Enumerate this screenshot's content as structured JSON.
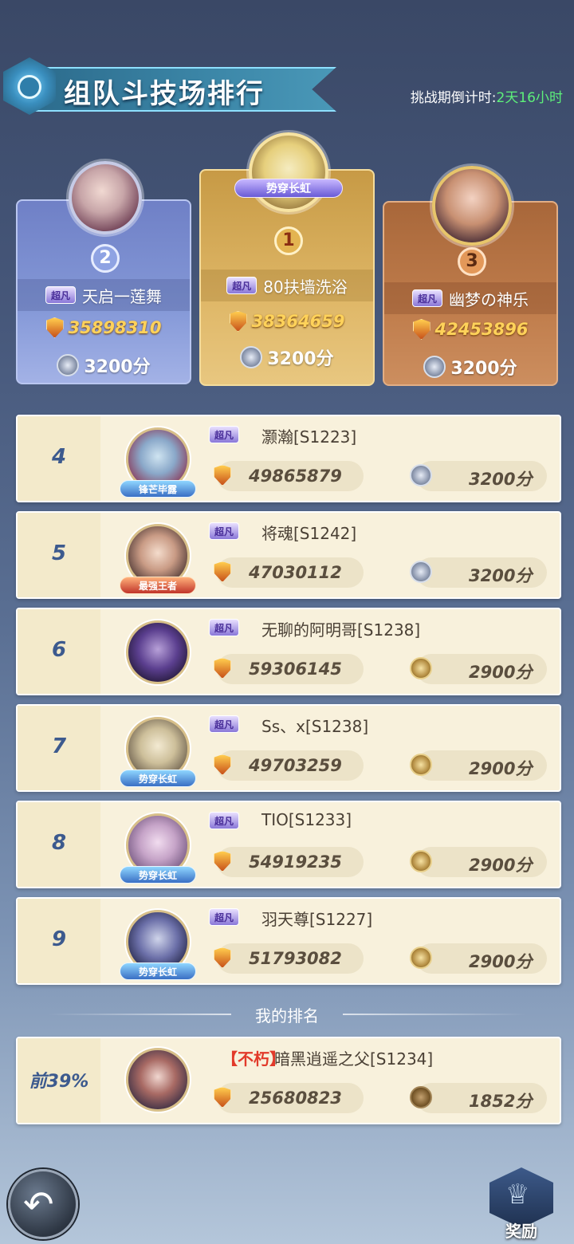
{
  "header": {
    "title": "组队斗技场排行",
    "countdown_label": "挑战期倒计时:",
    "countdown_value": "2天16小时"
  },
  "top3": [
    {
      "rank": "1",
      "tag": "势穿长虹",
      "tier": "超凡",
      "name": "80扶墙洗浴",
      "power": "38364659",
      "score": "3200分"
    },
    {
      "rank": "2",
      "tier": "超凡",
      "name": "天启一莲舞",
      "power": "35898310",
      "score": "3200分"
    },
    {
      "rank": "3",
      "tier": "超凡",
      "name": "幽梦の神乐",
      "power": "42453896",
      "score": "3200分"
    }
  ],
  "list": [
    {
      "rank": "4",
      "badge": "锋芒毕露",
      "tier": "超凡",
      "name": "灏瀚[S1223]",
      "power": "49865879",
      "score": "3200分",
      "crest": "silver"
    },
    {
      "rank": "5",
      "badge": "最强王者",
      "tier": "超凡",
      "name": "将魂[S1242]",
      "power": "47030112",
      "score": "3200分",
      "crest": "silver"
    },
    {
      "rank": "6",
      "badge": "",
      "tier": "超凡",
      "name": "无聊的阿明哥[S1238]",
      "power": "59306145",
      "score": "2900分",
      "crest": "gold"
    },
    {
      "rank": "7",
      "badge": "势穿长虹",
      "tier": "超凡",
      "name": "Ss、x[S1238]",
      "power": "49703259",
      "score": "2900分",
      "crest": "gold"
    },
    {
      "rank": "8",
      "badge": "势穿长虹",
      "tier": "超凡",
      "name": "TIO[S1233]",
      "power": "54919235",
      "score": "2900分",
      "crest": "gold"
    },
    {
      "rank": "9",
      "badge": "势穿长虹",
      "tier": "超凡",
      "name": "羽天尊[S1227]",
      "power": "51793082",
      "score": "2900分",
      "crest": "gold"
    }
  ],
  "my_rank": {
    "section_title": "我的排名",
    "rank": "前39%",
    "tier": "【不朽】",
    "name": "暗黑逍遥之父[S1234]",
    "power": "25680823",
    "score": "1852分"
  },
  "footer": {
    "reward_label": "奖励",
    "back_glyph": "↶",
    "reward_glyph": "♕"
  }
}
